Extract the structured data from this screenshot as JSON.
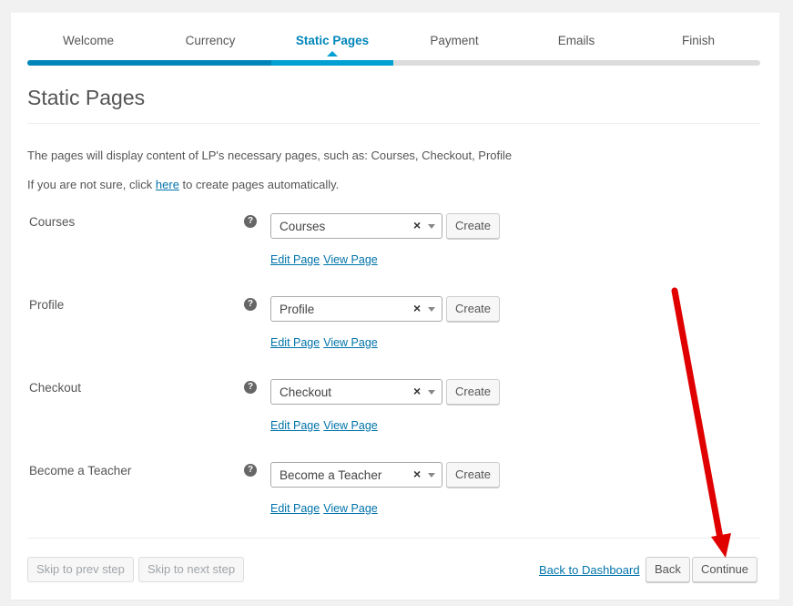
{
  "steps": [
    {
      "label": "Welcome"
    },
    {
      "label": "Currency"
    },
    {
      "label": "Static Pages"
    },
    {
      "label": "Payment"
    },
    {
      "label": "Emails"
    },
    {
      "label": "Finish"
    }
  ],
  "current_step": "Static Pages",
  "progress": {
    "completed_steps": 2,
    "current_step_index": 2,
    "total_steps": 6
  },
  "page_title": "Static Pages",
  "description": "The pages will display content of LP's necessary pages, such as: Courses, Checkout, Profile",
  "auto_create": {
    "before": "If you are not sure, click ",
    "link": "here",
    "after": " to create pages automatically."
  },
  "rows": [
    {
      "label": "Courses",
      "selected": "Courses",
      "create_label": "Create",
      "edit_label": "Edit Page",
      "view_label": "View Page"
    },
    {
      "label": "Profile",
      "selected": "Profile",
      "create_label": "Create",
      "edit_label": "Edit Page",
      "view_label": "View Page"
    },
    {
      "label": "Checkout",
      "selected": "Checkout",
      "create_label": "Create",
      "edit_label": "Edit Page",
      "view_label": "View Page"
    },
    {
      "label": "Become a Teacher",
      "selected": "Become a Teacher",
      "create_label": "Create",
      "edit_label": "Edit Page",
      "view_label": "View Page"
    }
  ],
  "help_glyph": "?",
  "clear_glyph": "×",
  "footer": {
    "prev_label": "Skip to prev step",
    "next_label": "Skip to next step",
    "dashboard_label": "Back to Dashboard",
    "back_label": "Back",
    "continue_label": "Continue"
  },
  "colors": {
    "accent": "#0085ba",
    "accent_light": "#00a0d2",
    "annotation_arrow": "#e00000"
  },
  "icons": [
    "help-icon",
    "clear-icon",
    "dropdown-arrow-icon",
    "annotation-arrow-icon"
  ]
}
